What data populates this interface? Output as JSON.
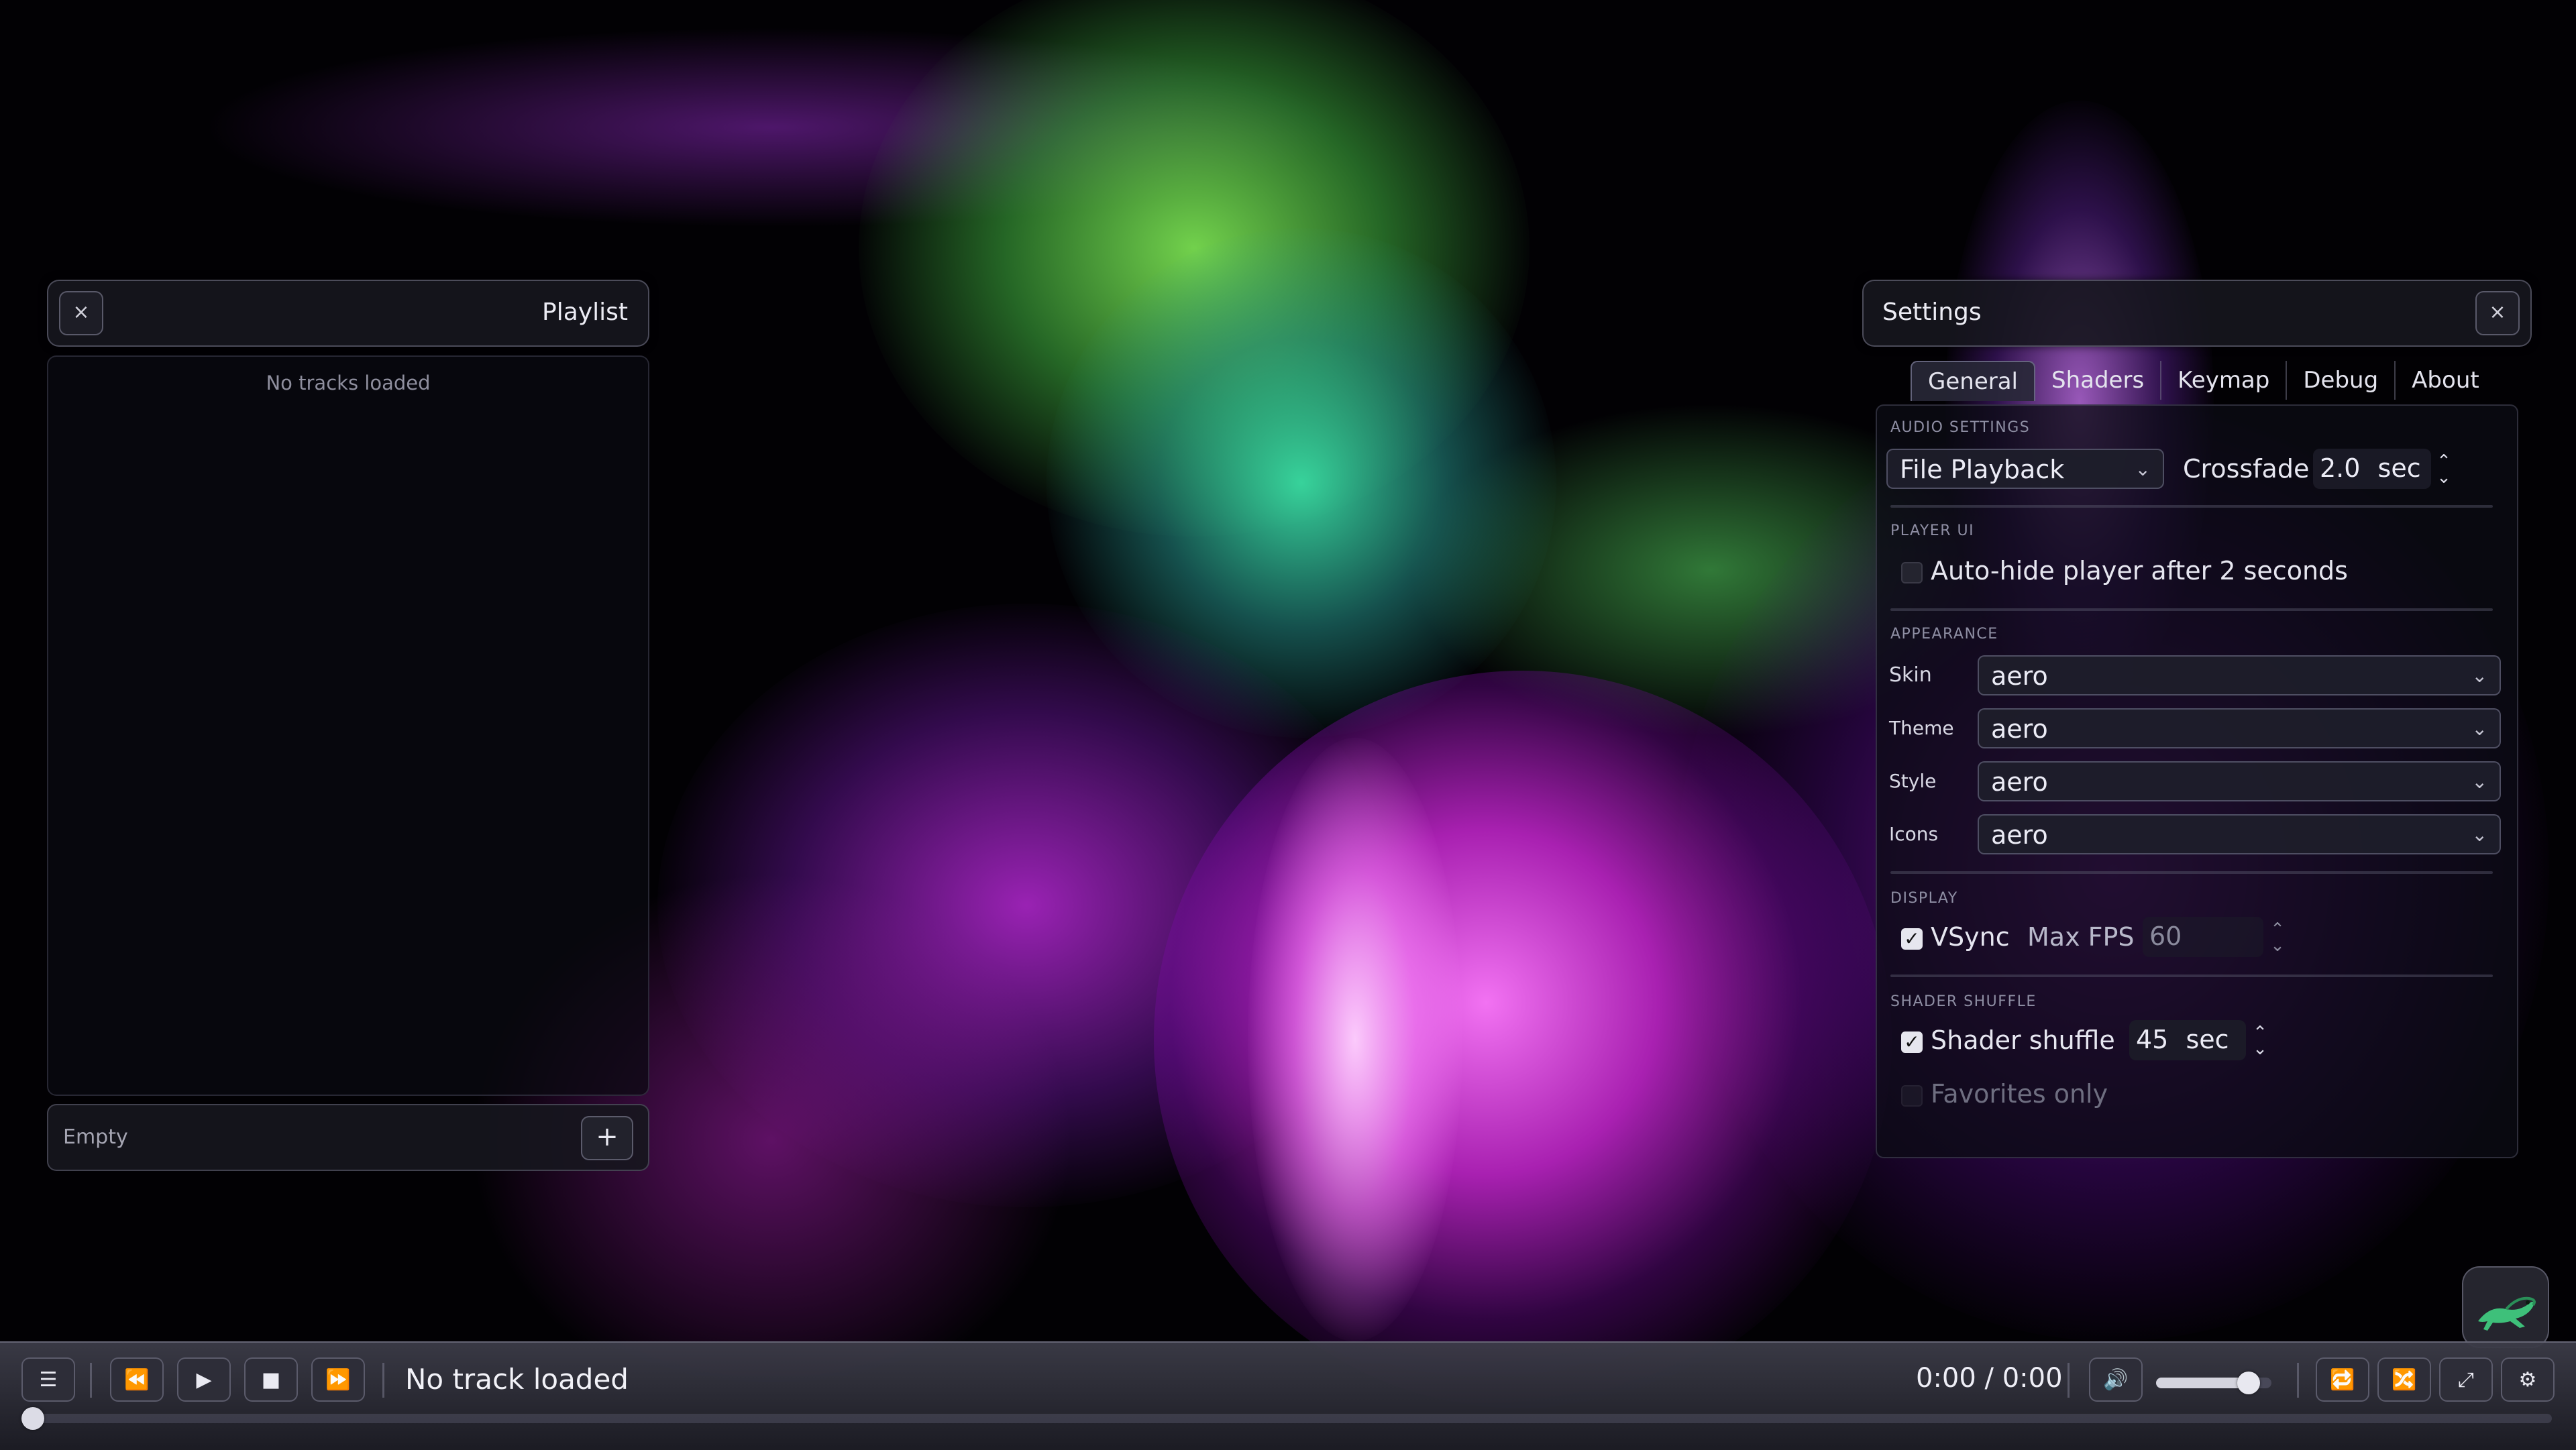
{
  "playlist": {
    "title": "Playlist",
    "close_label": "×",
    "empty_message": "No tracks loaded",
    "footer_label": "Empty",
    "add_label": "+"
  },
  "settings": {
    "title": "Settings",
    "close_label": "×",
    "tabs": [
      "General",
      "Shaders",
      "Keymap",
      "Debug",
      "About"
    ],
    "active_tab": "General",
    "audio": {
      "section": "AUDIO SETTINGS",
      "source": "File Playback",
      "crossfade_label": "Crossfade",
      "crossfade_value": "2.0",
      "crossfade_unit": "sec"
    },
    "player_ui": {
      "section": "PLAYER UI",
      "autohide_label": "Auto-hide player after 2 seconds",
      "autohide_checked": false
    },
    "appearance": {
      "section": "APPEARANCE",
      "rows": [
        {
          "label": "Skin",
          "value": "aero"
        },
        {
          "label": "Theme",
          "value": "aero"
        },
        {
          "label": "Style",
          "value": "aero"
        },
        {
          "label": "Icons",
          "value": "aero"
        }
      ]
    },
    "display": {
      "section": "DISPLAY",
      "vsync_label": "VSync",
      "vsync_checked": true,
      "maxfps_label": "Max FPS",
      "maxfps_value": "60"
    },
    "shader_shuffle": {
      "section": "SHADER SHUFFLE",
      "shuffle_label": "Shader shuffle",
      "shuffle_checked": true,
      "shuffle_value": "45",
      "shuffle_unit": "sec",
      "favorites_label": "Favorites only",
      "favorites_checked": false
    }
  },
  "player": {
    "track_title": "No track loaded",
    "time_current": "0:00",
    "time_separator": "/",
    "time_total": "0:00",
    "time_display": "0:00 / 0:00",
    "volume_level": 0.8,
    "seek_position": 0,
    "icons": {
      "playlist": "list-icon",
      "prev": "rewind-icon",
      "play": "play-icon",
      "stop": "stop-icon",
      "next": "fast-forward-icon",
      "volume": "speaker-icon",
      "repeat": "repeat-icon",
      "shuffle": "shuffle-icon",
      "fullscreen": "expand-icon",
      "settings": "gear-icon"
    }
  },
  "colors": {
    "accent_green": "#6fd460",
    "accent_magenta": "#d83ce0",
    "panel_bg": "#16161e"
  }
}
